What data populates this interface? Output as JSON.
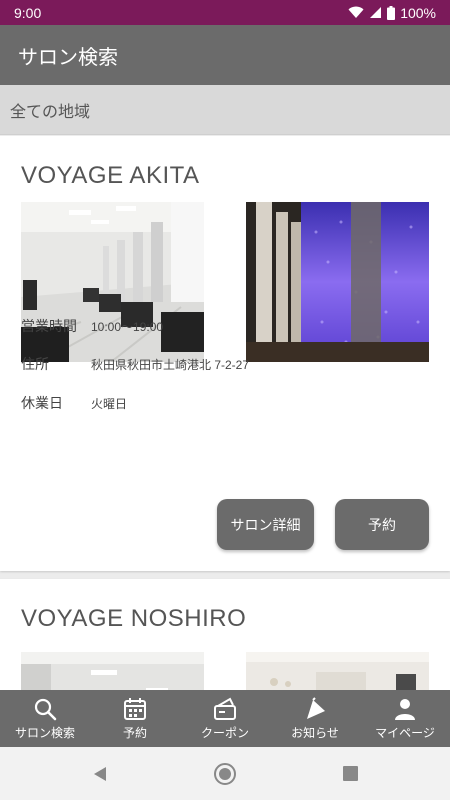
{
  "status_bar": {
    "time": "9:00",
    "battery": "100%"
  },
  "app_bar": {
    "title": "サロン検索"
  },
  "region": {
    "label": "全ての地域"
  },
  "salons": [
    {
      "name": "VOYAGE AKITA",
      "hours_label": "営業時間",
      "hours": "10:00〜19:00",
      "address_label": "住所",
      "address": "秋田県秋田市土崎港北 7-2-27",
      "holiday_label": "休業日",
      "holiday": "火曜日",
      "detail_button": "サロン詳細",
      "reserve_button": "予約"
    },
    {
      "name": "VOYAGE NOSHIRO"
    }
  ],
  "bottom_nav": [
    {
      "label": "サロン検索",
      "icon": "search-icon"
    },
    {
      "label": "予約",
      "icon": "calendar-icon"
    },
    {
      "label": "クーポン",
      "icon": "coupon-icon"
    },
    {
      "label": "お知らせ",
      "icon": "megaphone-icon"
    },
    {
      "label": "マイページ",
      "icon": "person-icon"
    }
  ],
  "colors": {
    "status_bar": "#7b1a5a",
    "app_bar": "#6b6b6b",
    "button": "#6b6b6b",
    "region_bar": "#d9d9d9"
  }
}
